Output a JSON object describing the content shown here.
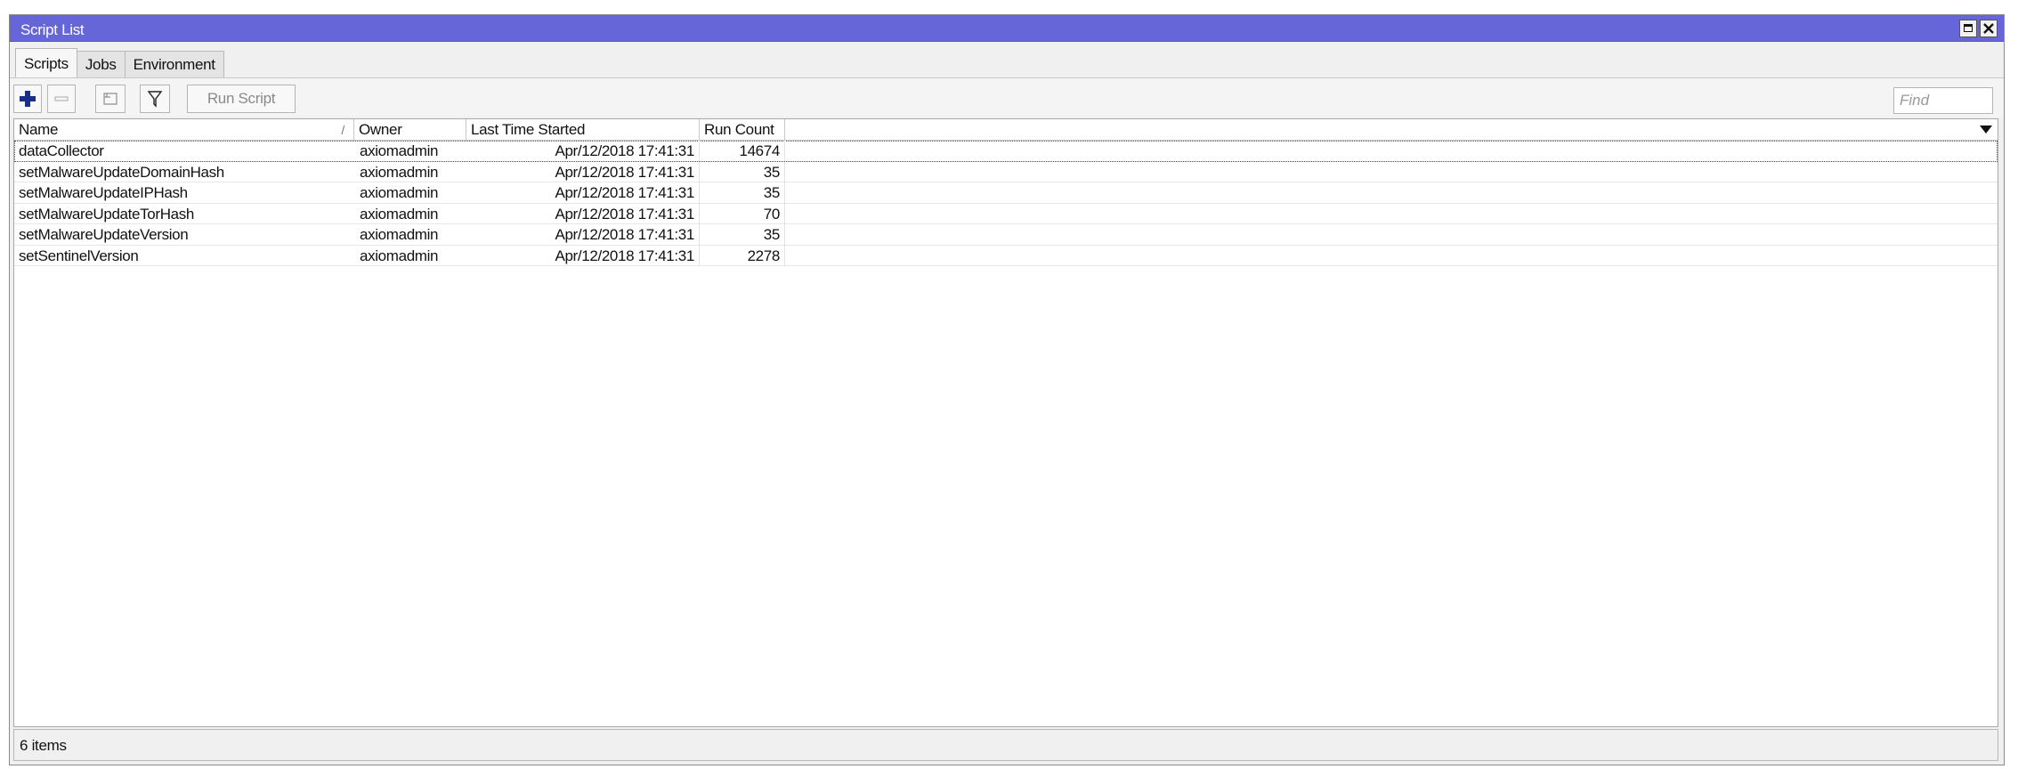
{
  "window": {
    "title": "Script List"
  },
  "tabs": [
    {
      "label": "Scripts",
      "active": true
    },
    {
      "label": "Jobs",
      "active": false
    },
    {
      "label": "Environment",
      "active": false
    }
  ],
  "toolbar": {
    "add_icon": "plus-icon",
    "remove_icon": "minus-icon",
    "comment_icon": "comment-icon",
    "filter_icon": "filter-icon",
    "run_label": "Run Script",
    "find_placeholder": "Find"
  },
  "table": {
    "columns": [
      "Name",
      "Owner",
      "Last Time Started",
      "Run Count"
    ],
    "sort_indicator": "/",
    "rows": [
      {
        "name": "dataCollector",
        "owner": "axiomadmin",
        "last_started": "Apr/12/2018 17:41:31",
        "run_count": "14674"
      },
      {
        "name": "setMalwareUpdateDomainHash",
        "owner": "axiomadmin",
        "last_started": "Apr/12/2018 17:41:31",
        "run_count": "35"
      },
      {
        "name": "setMalwareUpdateIPHash",
        "owner": "axiomadmin",
        "last_started": "Apr/12/2018 17:41:31",
        "run_count": "35"
      },
      {
        "name": "setMalwareUpdateTorHash",
        "owner": "axiomadmin",
        "last_started": "Apr/12/2018 17:41:31",
        "run_count": "70"
      },
      {
        "name": "setMalwareUpdateVersion",
        "owner": "axiomadmin",
        "last_started": "Apr/12/2018 17:41:31",
        "run_count": "35"
      },
      {
        "name": "setSentinelVersion",
        "owner": "axiomadmin",
        "last_started": "Apr/12/2018 17:41:31",
        "run_count": "2278"
      }
    ]
  },
  "status": {
    "text": "6 items"
  },
  "colors": {
    "titlebar": "#6666d8",
    "add_icon": "#1a2f8a",
    "window_bg": "#f0f0f0"
  }
}
